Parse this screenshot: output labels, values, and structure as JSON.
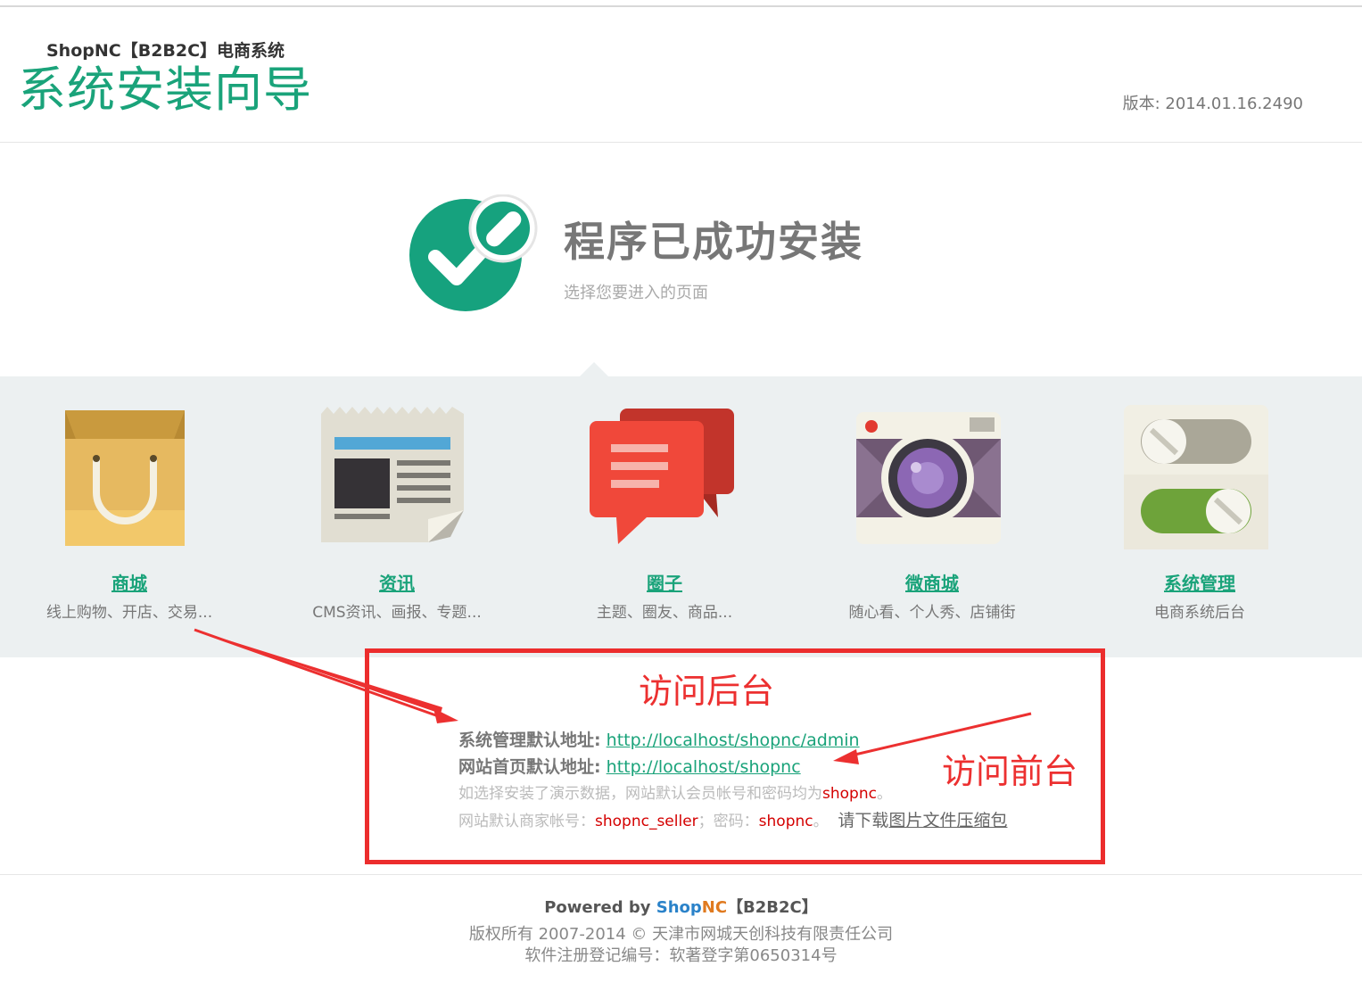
{
  "header": {
    "brand": "ShopNC【B2B2C】电商系统",
    "title": "系统安装向导",
    "version": "版本: 2014.01.16.2490"
  },
  "success": {
    "title": "程序已成功安装",
    "subtitle": "选择您要进入的页面"
  },
  "modules": [
    {
      "name": "商城",
      "desc": "线上购物、开店、交易...",
      "icon": "shopping-bag-icon"
    },
    {
      "name": "资讯",
      "desc": "CMS资讯、画报、专题...",
      "icon": "newspaper-icon"
    },
    {
      "name": "圈子",
      "desc": "主题、圈友、商品...",
      "icon": "chat-bubbles-icon"
    },
    {
      "name": "微商城",
      "desc": "随心看、个人秀、店铺街",
      "icon": "camera-icon"
    },
    {
      "name": "系统管理",
      "desc": "电商系统后台",
      "icon": "toggle-switches-icon"
    }
  ],
  "info": {
    "admin_label": "系统管理默认地址:",
    "admin_url": "http://localhost/shopnc/admin",
    "home_label": "网站首页默认地址:",
    "home_url": "http://localhost/shopnc",
    "demo_note": "如选择安装了演示数据，网站默认会员帐号和密码均为",
    "demo_value": "shopnc",
    "demo_end": "。",
    "seller_label": "网站默认商家帐号：",
    "seller_value": "shopnc_seller",
    "pwd_label": "；密码：",
    "pwd_value": "shopnc",
    "pwd_end": "。",
    "download_prefix": "请下载",
    "download_link": "图片文件压缩包"
  },
  "annotations": {
    "backend": "访问后台",
    "frontend": "访问前台"
  },
  "footer": {
    "powered_prefix": "Powered by ",
    "powered_shop": "Shop",
    "powered_nc": "NC",
    "powered_suffix": "【B2B2C】",
    "copyright": "版权所有 2007-2014 © 天津市网城天创科技有限责任公司",
    "registration": "软件注册登记编号：软著登字第0650314号"
  },
  "colors": {
    "accent": "#1aa37a",
    "annotation": "#ec3030",
    "panel": "#ecf0f1"
  }
}
